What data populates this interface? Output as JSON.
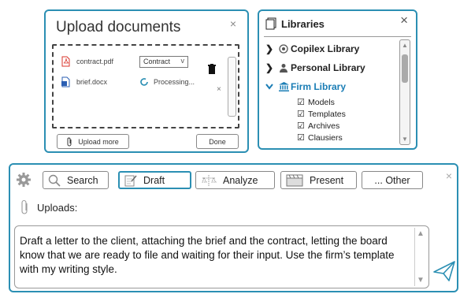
{
  "upload_dialog": {
    "title": "Upload documents",
    "close": "×",
    "files": [
      {
        "name": "contract.pdf",
        "type_selected": "Contract",
        "icon": "pdf-file-icon"
      },
      {
        "name": "brief.docx",
        "status": "Processing...",
        "icon": "word-file-icon"
      }
    ],
    "remove": "×",
    "upload_more_label": "Upload more",
    "done_label": "Done"
  },
  "libraries": {
    "title": "Libraries",
    "close": "×",
    "items": [
      {
        "label": "Copilex Library",
        "expanded": false,
        "icon": "copilex-icon"
      },
      {
        "label": "Personal Library",
        "expanded": false,
        "icon": "person-icon"
      },
      {
        "label": "Firm Library",
        "expanded": true,
        "icon": "bank-icon",
        "children": [
          "Models",
          "Templates",
          "Archives",
          "Clausiers"
        ]
      }
    ]
  },
  "composer": {
    "modes": [
      {
        "label": "Search",
        "icon": "search-icon"
      },
      {
        "label": "Draft",
        "icon": "draft-icon",
        "active": true
      },
      {
        "label": "Analyze",
        "icon": "analyze-icon"
      },
      {
        "label": "Present",
        "icon": "present-icon"
      },
      {
        "label": "... Other"
      }
    ],
    "close": "×",
    "uploads_label": "Uploads:",
    "prompt": "Draft a letter to the client, attaching the brief and the contract, letting the board know that we are ready to file and waiting for their input. Use the firm’s template with my writing style."
  },
  "colors": {
    "accent": "#2b8fb3",
    "firm_library": "#1a7db5",
    "pdf": "#d9342b",
    "word": "#2b5fb3"
  }
}
